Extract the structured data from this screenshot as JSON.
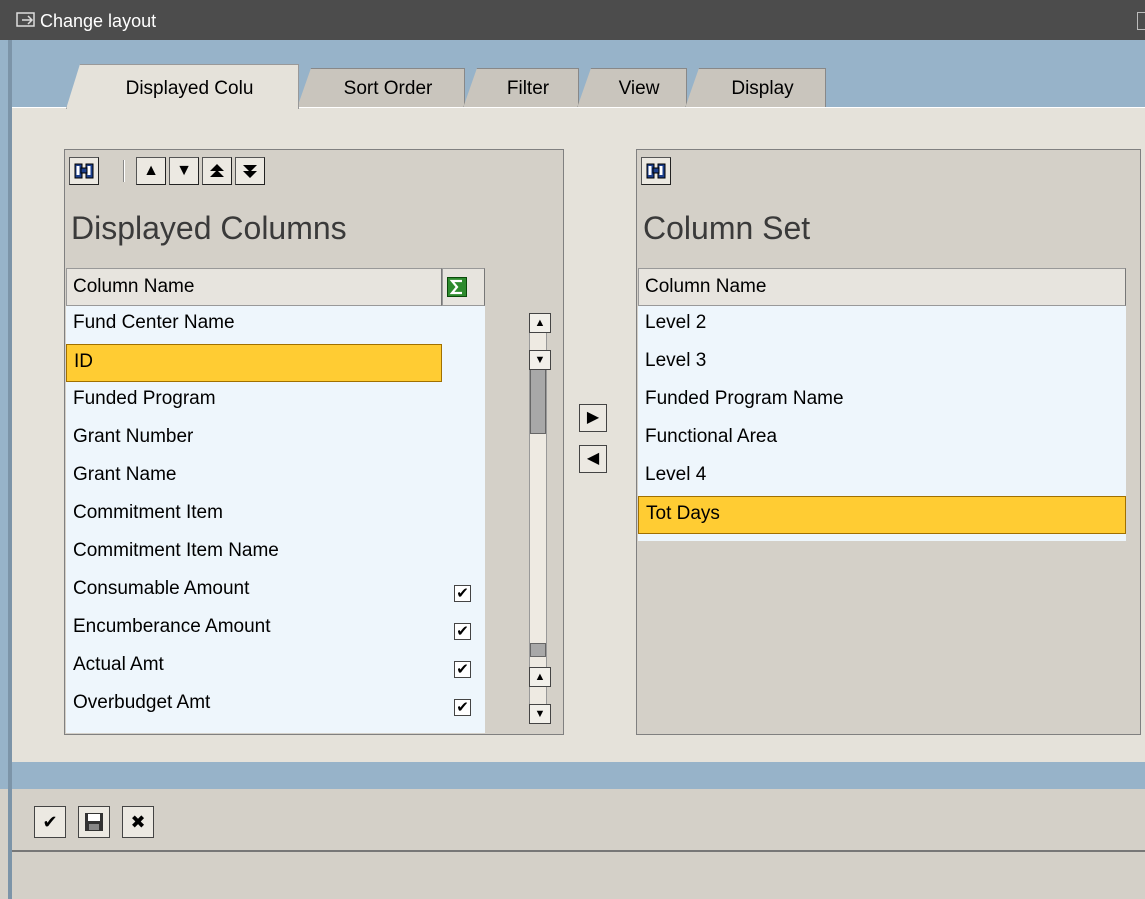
{
  "window": {
    "title": "Change layout"
  },
  "tabs": [
    {
      "label": "Displayed Colu"
    },
    {
      "label": "Sort Order"
    },
    {
      "label": "Filter"
    },
    {
      "label": "View"
    },
    {
      "label": "Display"
    }
  ],
  "left_panel": {
    "title": "Displayed Columns",
    "column_header": "Column Name",
    "rows": [
      {
        "label": "Fund Center Name",
        "selected": false,
        "checked": false
      },
      {
        "label": "ID",
        "selected": true,
        "checked": false
      },
      {
        "label": "Funded Program",
        "selected": false,
        "checked": false
      },
      {
        "label": "Grant Number",
        "selected": false,
        "checked": false
      },
      {
        "label": "Grant Name",
        "selected": false,
        "checked": false
      },
      {
        "label": "Commitment Item",
        "selected": false,
        "checked": false
      },
      {
        "label": "Commitment Item Name",
        "selected": false,
        "checked": false
      },
      {
        "label": "Consumable Amount",
        "selected": false,
        "checked": true
      },
      {
        "label": "Encumberance Amount",
        "selected": false,
        "checked": true
      },
      {
        "label": "Actual Amt",
        "selected": false,
        "checked": true
      },
      {
        "label": "Overbudget Amt",
        "selected": false,
        "checked": true
      }
    ]
  },
  "right_panel": {
    "title": "Column Set",
    "column_header": "Column Name",
    "rows": [
      {
        "label": "Level 2",
        "selected": false
      },
      {
        "label": "Level 3",
        "selected": false
      },
      {
        "label": "Funded Program Name",
        "selected": false
      },
      {
        "label": "Functional Area",
        "selected": false
      },
      {
        "label": "Level 4",
        "selected": false
      },
      {
        "label": "Tot Days",
        "selected": true
      }
    ]
  },
  "colors": {
    "selection": "#ffcc33",
    "list_background": "#eef6fc",
    "frame": "#97b3c9",
    "titlebar": "#4c4c4c"
  },
  "icons": {
    "find": "binoculars-icon",
    "up": "move-up-icon",
    "down": "move-down-icon",
    "top": "move-to-top-icon",
    "bottom": "move-to-bottom-icon",
    "sum": "sigma-icon",
    "add": "arrow-right-icon",
    "remove": "arrow-left-icon",
    "confirm": "checkmark-icon",
    "save": "save-icon",
    "cancel": "cancel-icon"
  }
}
